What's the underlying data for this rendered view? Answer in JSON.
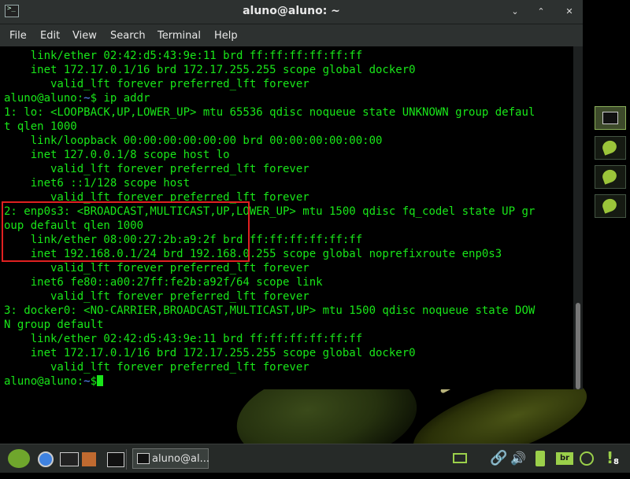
{
  "window": {
    "title": "aluno@aluno: ~",
    "minimize_icon": "⌄",
    "maximize_icon": "⌃",
    "close_icon": "✕"
  },
  "menu": [
    "File",
    "Edit",
    "View",
    "Search",
    "Terminal",
    "Help"
  ],
  "terminal": {
    "lines": [
      "    link/ether 02:42:d5:43:9e:11 brd ff:ff:ff:ff:ff:ff",
      "    inet 172.17.0.1/16 brd 172.17.255.255 scope global docker0",
      "       valid_lft forever preferred_lft forever",
      "aluno@aluno:~$ ip addr",
      "1: lo: <LOOPBACK,UP,LOWER_UP> mtu 65536 qdisc noqueue state UNKNOWN group defaul",
      "t qlen 1000",
      "    link/loopback 00:00:00:00:00:00 brd 00:00:00:00:00:00",
      "    inet 127.0.0.1/8 scope host lo",
      "       valid_lft forever preferred_lft forever",
      "    inet6 ::1/128 scope host",
      "       valid_lft forever preferred_lft forever",
      "2: enp0s3: <BROADCAST,MULTICAST,UP,LOWER_UP> mtu 1500 qdisc fq_codel state UP gr",
      "oup default qlen 1000",
      "    link/ether 08:00:27:2b:a9:2f brd ff:ff:ff:ff:ff:ff",
      "    inet 192.168.0.1/24 brd 192.168.0.255 scope global noprefixroute enp0s3",
      "       valid_lft forever preferred_lft forever",
      "    inet6 fe80::a00:27ff:fe2b:a92f/64 scope link",
      "       valid_lft forever preferred_lft forever",
      "3: docker0: <NO-CARRIER,BROADCAST,MULTICAST,UP> mtu 1500 qdisc noqueue state DOW",
      "N group default",
      "    link/ether 02:42:d5:43:9e:11 brd ff:ff:ff:ff:ff:ff",
      "    inet 172.17.0.1/16 brd 172.17.255.255 scope global docker0",
      "       valid_lft forever preferred_lft forever"
    ],
    "prompt_user": "aluno@aluno:",
    "prompt_path": "~",
    "prompt_symbol": "$",
    "prompt_line_index": 3
  },
  "taskbar": {
    "task_label": "aluno@al...",
    "keyboard_layout": "br",
    "notification_symbol": "!",
    "notification_count": "8"
  },
  "colors": {
    "terminal_text": "#19e619",
    "prompt_path": "#5b8cff",
    "highlight_border": "#e02020",
    "accent": "#9bd04a"
  }
}
